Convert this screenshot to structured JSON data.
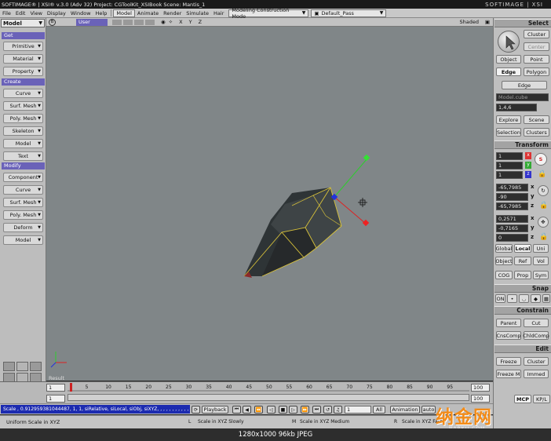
{
  "window": {
    "title": "SOFTIMAGE® | XSI® v.3.0 (Adv 32) Project: CGToolKit_XSIBook   Scene: Mantis_1",
    "brand": "SOFTIMAGE | XSI"
  },
  "menubar": {
    "items": [
      "File",
      "Edit",
      "View",
      "Display",
      "Window",
      "Help",
      "Model",
      "Animate",
      "Render",
      "Simulate",
      "Hair"
    ],
    "construction_mode": "Modeling Construction Mode",
    "pass": "Default_Pass"
  },
  "left_panel": {
    "mode": "Model",
    "get_header": "Get",
    "get_items": [
      "Primitive",
      "Material",
      "Property"
    ],
    "create_header": "Create",
    "create_items": [
      "Curve",
      "Surf. Mesh",
      "Poly. Mesh",
      "Skeleton",
      "Model",
      "Text"
    ],
    "modify_header": "Modify",
    "modify_items": [
      "Component",
      "Curve",
      "Surf. Mesh",
      "Poly. Mesh",
      "Deform",
      "Model"
    ]
  },
  "viewport": {
    "letter": "B",
    "camera": "User",
    "axes": "X Y Z",
    "shading": "Shaded"
  },
  "timeline": {
    "start_field": "1",
    "range_start": "1",
    "end_field": "100",
    "range_end": "100",
    "ticks": [
      "5",
      "10",
      "15",
      "20",
      "25",
      "30",
      "35",
      "40",
      "45",
      "50",
      "55",
      "60",
      "65",
      "70",
      "75",
      "80",
      "85",
      "90",
      "95"
    ],
    "result_label": "Result"
  },
  "command": {
    "script": "Scale , 0.912959381044487, 1, 1, siRelative, siLocal, siObj, siXYZ, , , , , , , , , , , , , , , , , ,",
    "playback": "Playback",
    "frame": "1",
    "all": "All",
    "animation": "Animation",
    "auto": "auto"
  },
  "status": {
    "message": "Uniform Scale in XYZ",
    "hint_l": "Scale in XYZ Slowly",
    "hint_m": "Scale in XYZ Medium",
    "hint_r": "Scale in XYZ Fast",
    "l": "L",
    "m": "M",
    "r": "R"
  },
  "right_panel": {
    "select_header": "Select",
    "cluster": "Cluster",
    "center": "Center",
    "object": "Object",
    "point": "Point",
    "edge": "Edge",
    "polygon": "Polygon",
    "edge_drop": "Edge",
    "selection_name": "Model.cube",
    "selection_index": "1,4,6",
    "explore": "Explore",
    "scene": "Scene",
    "selection": "Selection",
    "clusters": "Clusters",
    "transform_header": "Transform",
    "scale": [
      "1",
      "1",
      "1"
    ],
    "rotate": [
      "-65,7985",
      "-90",
      "-65,7985"
    ],
    "translate": [
      "0,2571",
      "-0,7165",
      "0"
    ],
    "axis_x": "x",
    "axis_y": "y",
    "axis_z": "z",
    "s": "S",
    "global": "Global",
    "local": "Local",
    "uni": "Uni",
    "object_ref": "Object",
    "ref": "Ref",
    "vol": "Vol",
    "cog": "COG",
    "prop": "Prop",
    "sym": "Sym",
    "snap_header": "Snap",
    "on": "ON",
    "constrain_header": "Constrain",
    "parent": "Parent",
    "cut": "Cut",
    "cnscomp": "CnsComp",
    "chldcomp": "ChldComp",
    "edit_header": "Edit",
    "freeze": "Freeze",
    "freeze_cluster": "Cluster",
    "freeze_m": "Freeze M",
    "immed": "Immed",
    "mcp": "MCP",
    "kpl": "KP/L"
  },
  "caption": "1280x1000  96kb  JPEG",
  "watermark": {
    "text": "纳金网",
    "sub": "NARKII.COM"
  }
}
